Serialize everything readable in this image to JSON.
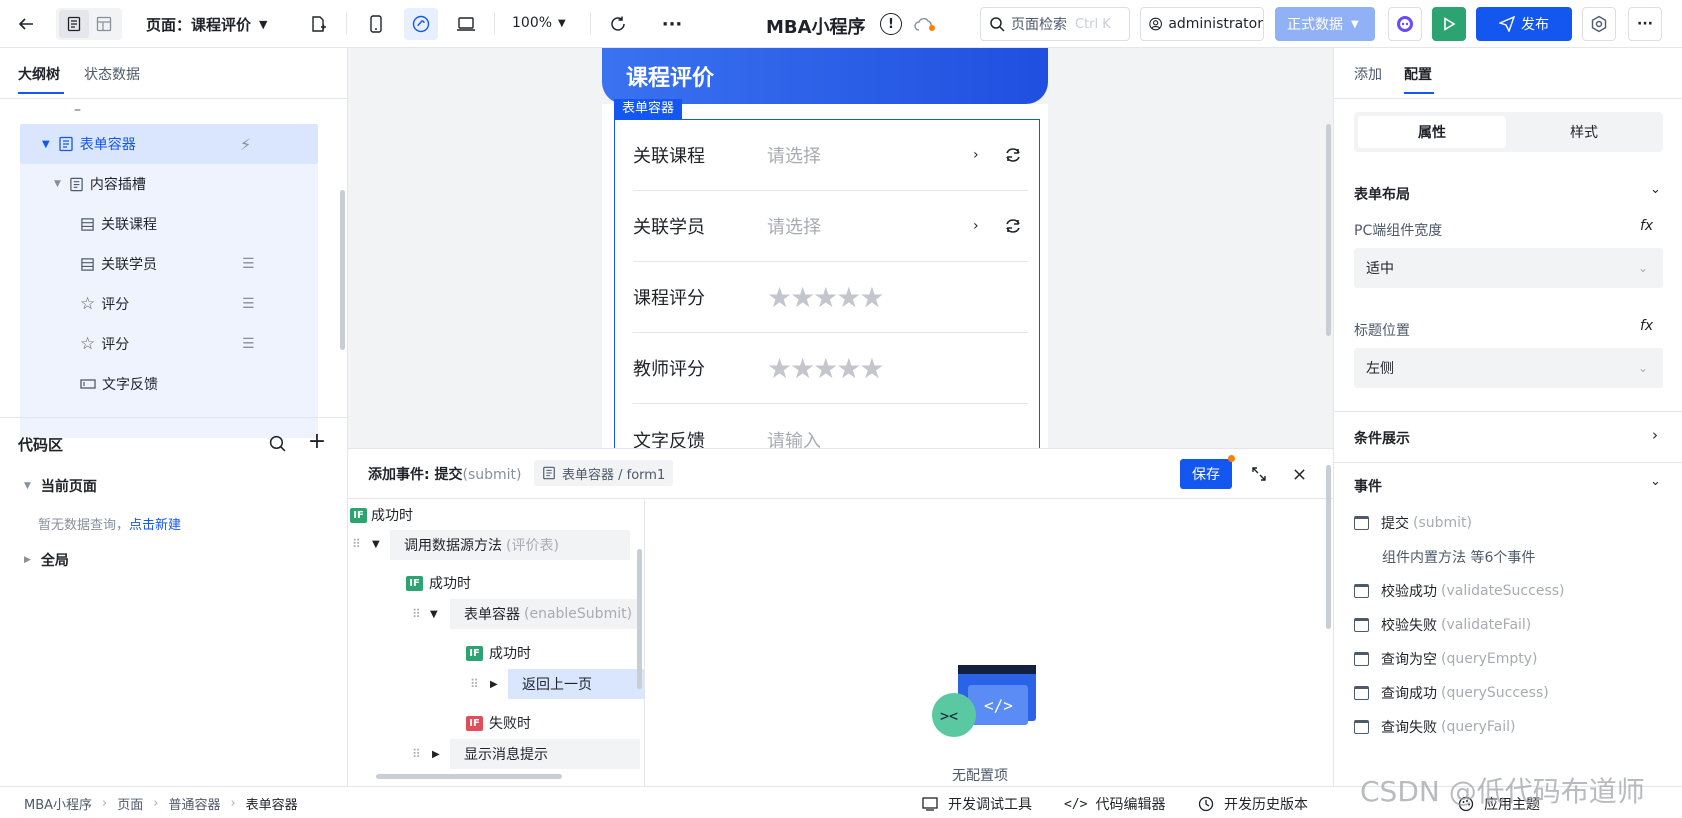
{
  "topbar": {
    "page_label": "页面：课程评价",
    "zoom": "100%",
    "app_title": "MBA小程序",
    "search_placeholder": "页面检索",
    "search_shortcut": "Ctrl K",
    "user": "administrator",
    "env": "正式数据",
    "publish": "发布"
  },
  "left": {
    "tabs": [
      "大纲树",
      "状态数据"
    ],
    "tree": {
      "form_container": "表单容器",
      "slot": "内容插槽",
      "items": [
        "关联课程",
        "关联学员",
        "评分",
        "评分",
        "文字反馈"
      ]
    },
    "code": {
      "title": "代码区",
      "current_page": "当前页面",
      "empty": "暂无数据查询，",
      "create_link": "点击新建",
      "global": "全局"
    }
  },
  "canvas": {
    "header_title": "课程评价",
    "container_tag": "表单容器",
    "fields": [
      {
        "label": "关联课程",
        "placeholder": "请选择",
        "kind": "select"
      },
      {
        "label": "关联学员",
        "placeholder": "请选择",
        "kind": "select"
      },
      {
        "label": "课程评分",
        "kind": "rating",
        "stars": "★★★★★"
      },
      {
        "label": "教师评分",
        "kind": "rating",
        "stars": "★★★★★"
      },
      {
        "label": "文字反馈",
        "placeholder": "请输入",
        "kind": "input"
      }
    ]
  },
  "event_panel": {
    "title": "添加事件: 提交",
    "title_code": "(submit)",
    "target": "表单容器 / form1",
    "save": "保存",
    "empty": "无配置项",
    "flow": {
      "success_top": "成功时",
      "call_ds": "调用数据源方法",
      "call_ds_arg": "(评价表)",
      "success_1": "成功时",
      "form_container": "表单容器",
      "form_container_arg": "(enableSubmit)",
      "success_2": "成功时",
      "go_back": "返回上一页",
      "fail": "失败时",
      "show_msg": "显示消息提示"
    },
    "if_badge": "IF"
  },
  "right": {
    "tabs": [
      "添加",
      "配置"
    ],
    "seg": [
      "属性",
      "样式"
    ],
    "form_layout": "表单布局",
    "pc_width_label": "PC端组件宽度",
    "pc_width_value": "适中",
    "title_pos_label": "标题位置",
    "title_pos_value": "左侧",
    "cond_display": "条件展示",
    "events_title": "事件",
    "fx": "fx",
    "events": [
      {
        "name": "提交",
        "code": "(submit)"
      },
      {
        "name": "组件内置方法 等6个事件",
        "code": ""
      },
      {
        "name": "校验成功",
        "code": "(validateSuccess)"
      },
      {
        "name": "校验失败",
        "code": "(validateFail)"
      },
      {
        "name": "查询为空",
        "code": "(queryEmpty)"
      },
      {
        "name": "查询成功",
        "code": "(querySuccess)"
      },
      {
        "name": "查询失败",
        "code": "(queryFail)"
      }
    ]
  },
  "statusbar": {
    "breadcrumb": [
      "MBA小程序",
      "页面",
      "普通容器",
      "表单容器"
    ],
    "debug": "开发调试工具",
    "code_editor": "代码编辑器",
    "history": "开发历史版本",
    "theme": "应用主题"
  },
  "watermark": "CSDN @低代码布道师",
  "colors": {
    "primary": "#1456f0",
    "green": "#2ba471",
    "red": "#e34d59",
    "env": "#91b1f7"
  }
}
